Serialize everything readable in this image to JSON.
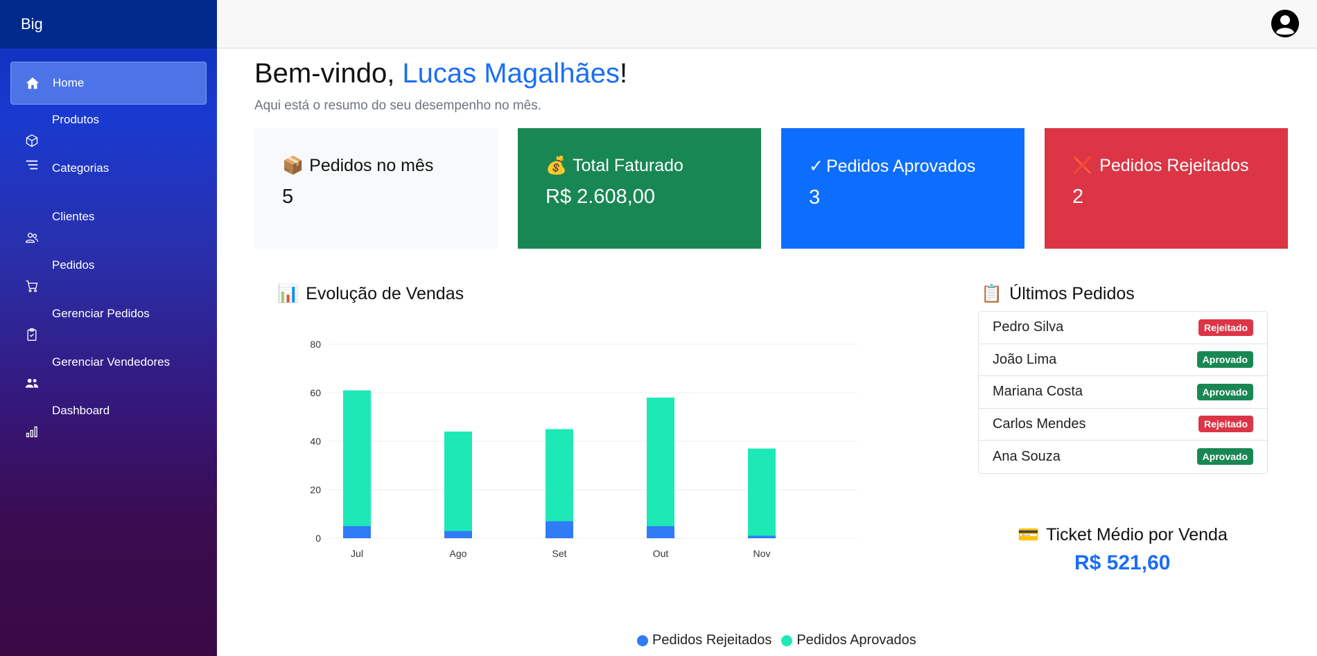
{
  "brand": "Big",
  "sidebar": {
    "items": [
      {
        "label": "Home",
        "icon": "home-icon",
        "active": true
      },
      {
        "label": "Produtos",
        "icon": "box-icon"
      },
      {
        "label": "Categorias",
        "icon": "list-icon"
      },
      {
        "label": "Clientes",
        "icon": "users-icon"
      },
      {
        "label": "Pedidos",
        "icon": "cart-icon"
      },
      {
        "label": "Gerenciar Pedidos",
        "icon": "clipboard-check-icon"
      },
      {
        "label": "Gerenciar Vendedores",
        "icon": "people-icon"
      },
      {
        "label": "Dashboard",
        "icon": "bar-chart-icon"
      }
    ]
  },
  "header": {
    "greeting": "Bem-vindo, ",
    "user_name": "Lucas Magalhães",
    "exclaim": "!",
    "subtitle": "Aqui está o resumo do seu desempenho no mês."
  },
  "cards": [
    {
      "emoji": "📦",
      "title": "Pedidos no mês",
      "value": "5",
      "color": "#f8f9fa"
    },
    {
      "emoji": "💰",
      "title": "Total Faturado",
      "value": "R$ 2.608,00",
      "color": "#198754"
    },
    {
      "emoji": "✓",
      "title": "Pedidos Aprovados",
      "value": "3",
      "color": "#0d6efd"
    },
    {
      "emoji": "❌",
      "title": "Pedidos Rejeitados",
      "value": "2",
      "color": "#dc3545"
    }
  ],
  "sales_section": {
    "emoji": "📊",
    "title": "Evolução de Vendas"
  },
  "chart_data": {
    "type": "bar",
    "stacked": true,
    "categories": [
      "Jul",
      "Ago",
      "Set",
      "Out",
      "Nov"
    ],
    "series": [
      {
        "name": "Pedidos Rejeitados",
        "values": [
          5,
          3,
          7,
          5,
          1
        ],
        "color": "#2f7cf6"
      },
      {
        "name": "Pedidos Aprovados",
        "values": [
          56,
          41,
          38,
          53,
          36
        ],
        "color": "#1de9b6"
      }
    ],
    "ylim": [
      0,
      80
    ],
    "yticks": [
      0,
      20,
      40,
      60,
      80
    ],
    "grid": true,
    "legend": "bottom"
  },
  "orders_section": {
    "emoji": "📋",
    "title": "Últimos Pedidos"
  },
  "orders": [
    {
      "name": "Pedro Silva",
      "status": "Rejeitado",
      "kind": "rej"
    },
    {
      "name": "João Lima",
      "status": "Aprovado",
      "kind": "apr"
    },
    {
      "name": "Mariana Costa",
      "status": "Aprovado",
      "kind": "apr"
    },
    {
      "name": "Carlos Mendes",
      "status": "Rejeitado",
      "kind": "rej"
    },
    {
      "name": "Ana Souza",
      "status": "Aprovado",
      "kind": "apr"
    }
  ],
  "ticket": {
    "emoji": "💳",
    "title": "Ticket Médio por Venda",
    "value": "R$ 521,60"
  }
}
